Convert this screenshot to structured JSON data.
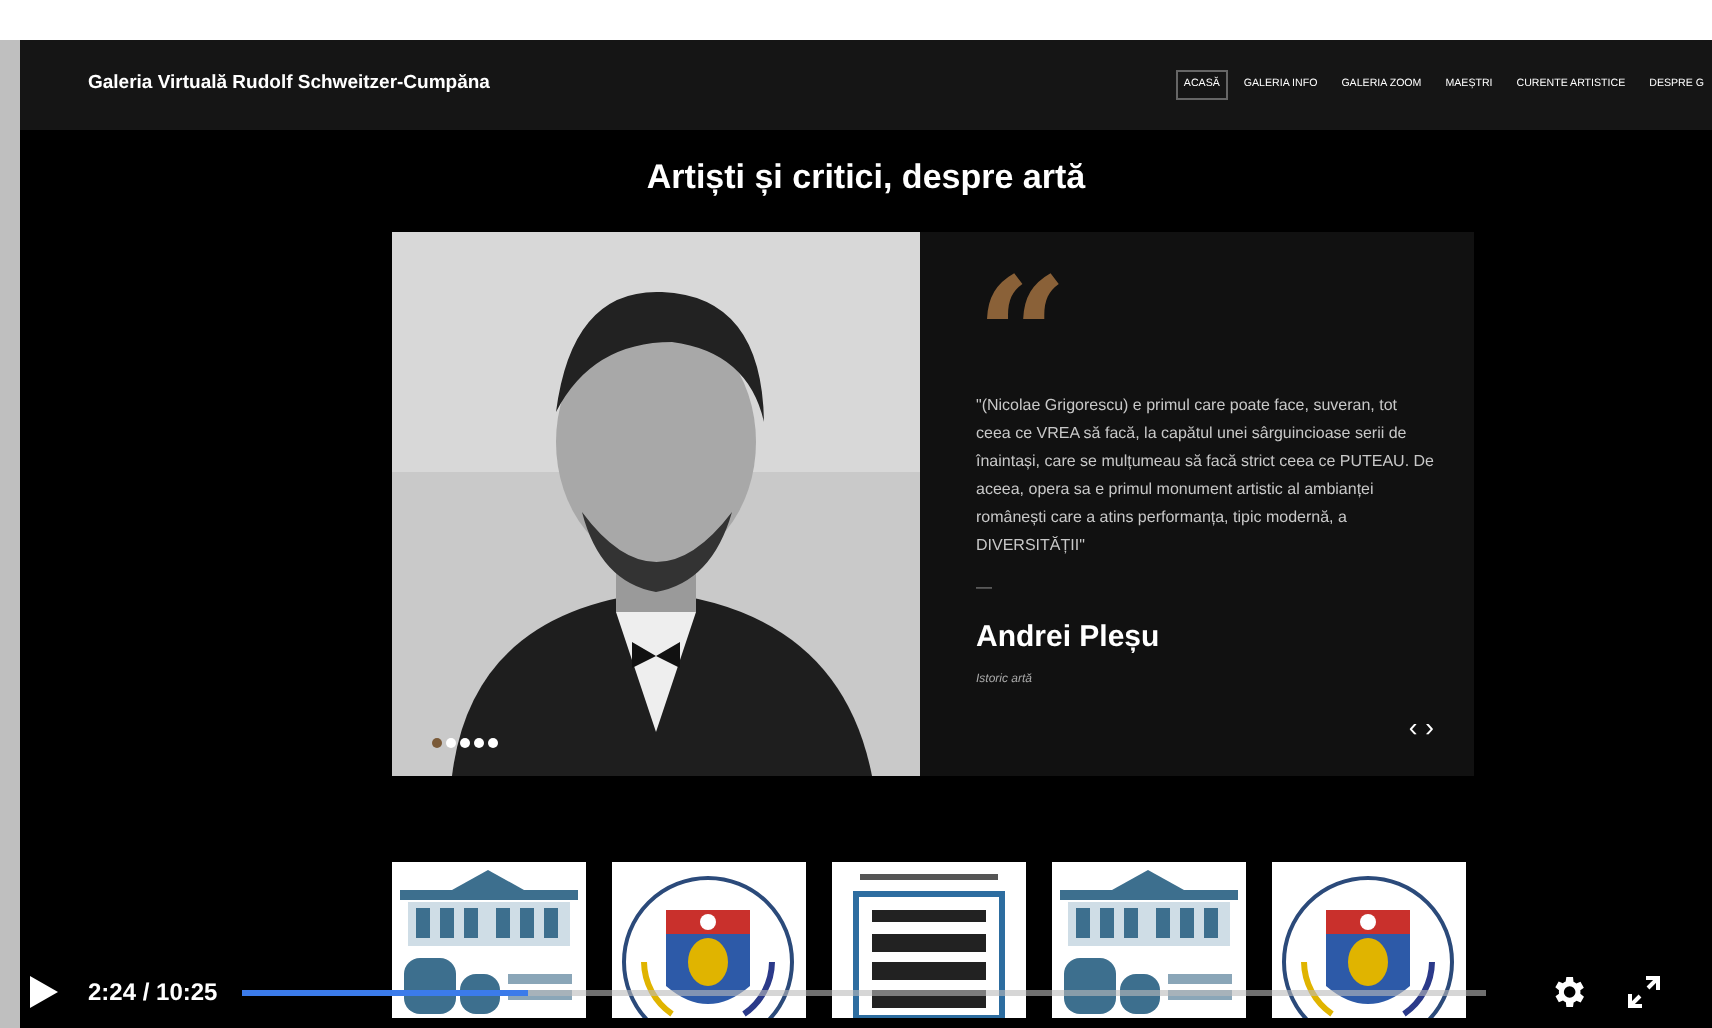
{
  "site": {
    "title": "Galeria Virtuală Rudolf Schweitzer-Cumpăna",
    "nav": [
      {
        "label": "ACASĂ",
        "selected": true
      },
      {
        "label": "GALERIA INFO",
        "selected": false
      },
      {
        "label": "GALERIA ZOOM",
        "selected": false
      },
      {
        "label": "MAEȘTRI",
        "selected": false
      },
      {
        "label": "CURENTE ARTISTICE",
        "selected": false
      },
      {
        "label": "DESPRE G",
        "selected": false
      }
    ],
    "heading": "Artiști și critici, despre artă",
    "testimonial": {
      "quote_mark": "“",
      "quote": "\"(Nicolae Grigorescu) e primul care poate face, suveran, tot ceea ce VREA să facă, la capătul unei sârguincioase serii de înaintași, care se mulțumeau să facă strict ceea ce PUTEAU. De aceea, opera sa e primul monument artistic al ambianței românești care a atins performanța, tipic modernă, a DIVERSITĂȚII\"",
      "dash": "—",
      "name": "Andrei Pleșu",
      "role": "Istoric artă",
      "prev": "‹",
      "next": "›"
    },
    "dots": [
      {
        "selected": true
      },
      {
        "selected": false
      },
      {
        "selected": false
      },
      {
        "selected": false
      },
      {
        "selected": false
      }
    ],
    "logos": [
      {
        "kind": "museum"
      },
      {
        "kind": "crest"
      },
      {
        "kind": "fund"
      },
      {
        "kind": "museum"
      },
      {
        "kind": "crest"
      }
    ]
  },
  "player": {
    "time": "2:24 / 10:25",
    "progress": {
      "level": 0.23
    }
  }
}
